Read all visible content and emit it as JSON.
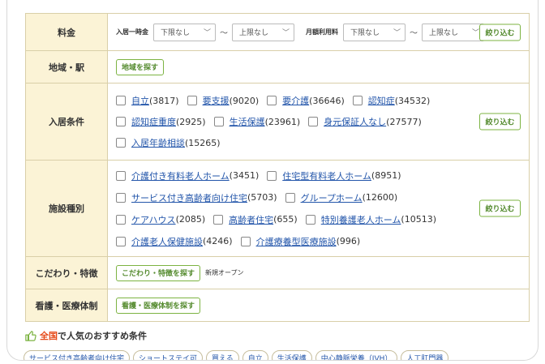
{
  "rows": {
    "price": {
      "label": "料金",
      "entry_label": "入居一時金",
      "monthly_label": "月額利用料",
      "entry_min": "下限なし",
      "entry_max": "上限なし",
      "monthly_min": "下限なし",
      "monthly_max": "上限なし",
      "tilde": "〜",
      "narrow_label": "絞り込む"
    },
    "area": {
      "label": "地域・駅",
      "button": "地域を探す"
    },
    "conditions": {
      "label": "入居条件",
      "narrow_label": "絞り込む",
      "items": [
        {
          "name": "自立",
          "count": "(3817)"
        },
        {
          "name": "要支援",
          "count": "(9020)"
        },
        {
          "name": "要介護",
          "count": "(36646)"
        },
        {
          "name": "認知症",
          "count": "(34532)"
        },
        {
          "name": "認知症重度",
          "count": "(2925)"
        },
        {
          "name": "生活保護",
          "count": "(23961)"
        },
        {
          "name": "身元保証人なし",
          "count": "(27577)"
        },
        {
          "name": "入居年齢相談",
          "count": "(15265)"
        }
      ]
    },
    "facility": {
      "label": "施設種別",
      "narrow_label": "絞り込む",
      "items": [
        {
          "name": "介護付き有料老人ホーム",
          "count": "(3451)"
        },
        {
          "name": "住宅型有料老人ホーム",
          "count": "(8951)"
        },
        {
          "name": "サービス付き高齢者向け住宅",
          "count": "(5703)"
        },
        {
          "name": "グループホーム",
          "count": "(12600)"
        },
        {
          "name": "ケアハウス",
          "count": "(2085)"
        },
        {
          "name": "高齢者住宅",
          "count": "(655)"
        },
        {
          "name": "特別養護老人ホーム",
          "count": "(10513)"
        },
        {
          "name": "介護老人保健施設",
          "count": "(4246)"
        },
        {
          "name": "介護療養型医療施設",
          "count": "(996)"
        }
      ]
    },
    "features": {
      "label": "こだわり・特徴",
      "button": "こだわり・特徴を探す",
      "extra": "新規オープン"
    },
    "medical": {
      "label": "看護・医療体制",
      "button": "看護・医療体制を探す"
    }
  },
  "popular": {
    "prefix": "全国",
    "suffix": "で人気のおすすめ条件",
    "icon": "thumbs-up-icon",
    "tags": [
      "サービス付き高齢者向け住宅",
      "ショートステイ可",
      "買える",
      "自立",
      "生活保護",
      "中心静脈栄養（IVH）",
      "人工肛門器"
    ]
  },
  "colors": {
    "accent_green": "#7cb342",
    "header_bg": "#fbf3d6",
    "link": "#2255aa",
    "highlight": "#e64a19"
  }
}
